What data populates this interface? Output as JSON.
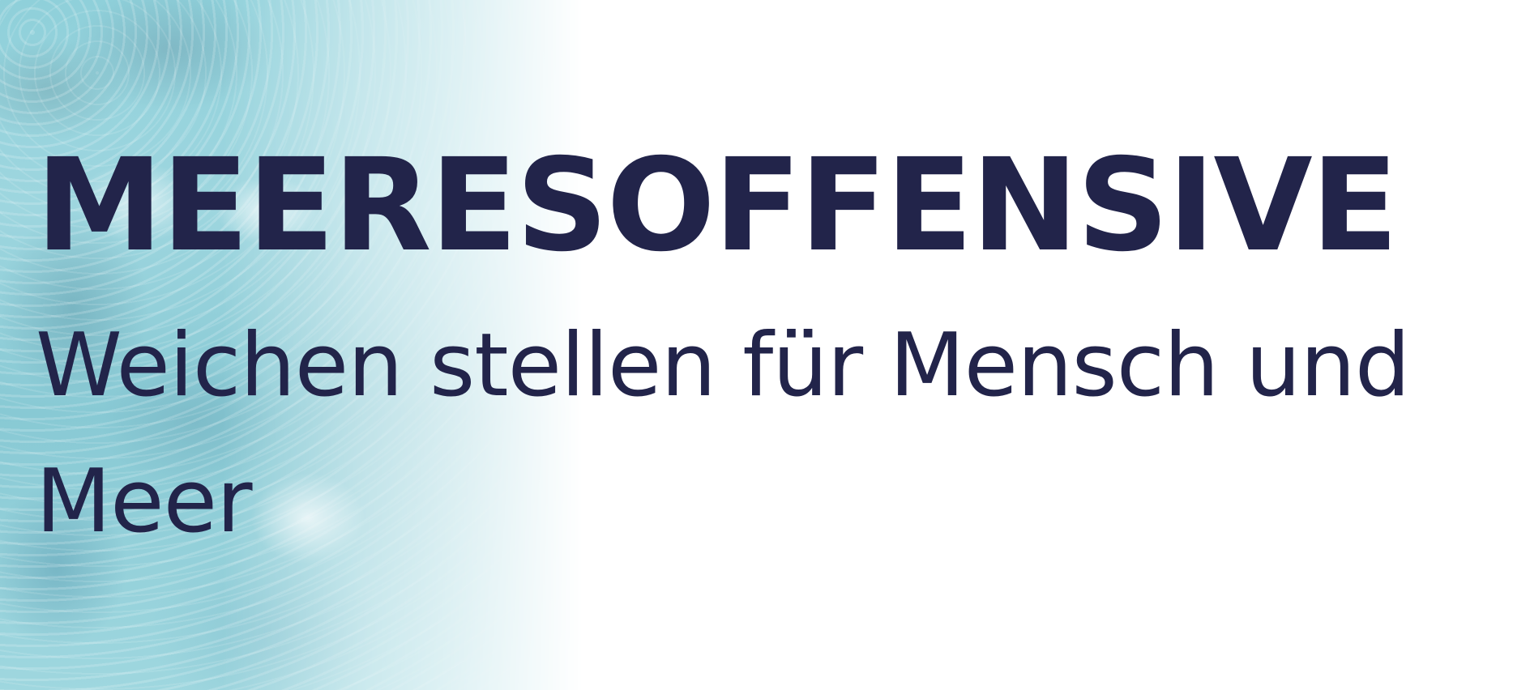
{
  "banner": {
    "title": "MEERESOFFENSIVE",
    "subtitle": "Weichen stellen für Mensch und Meer",
    "text_color": "#22244a",
    "background_color": "#ffffff",
    "sea_color": "#9ed6df"
  }
}
